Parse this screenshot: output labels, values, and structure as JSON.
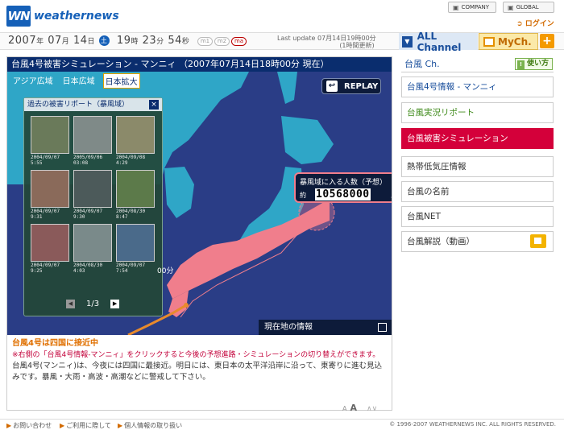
{
  "header": {
    "logo_mark": "WN",
    "logo_text": "weathernews",
    "company_label": "COMPANY",
    "global_label": "GLOBAL",
    "login_label": "ログイン"
  },
  "datebar": {
    "year": "2007",
    "y_unit": "年",
    "month": "07",
    "m_unit": "月",
    "day": "14",
    "d_unit": "日",
    "weekday": "土",
    "hour": "19",
    "h_unit": "時",
    "minute": "23",
    "min_unit": "分",
    "second": "54",
    "s_unit": "秒",
    "pills": [
      "m1",
      "m2",
      "ma"
    ],
    "update_text": "Last update  07月14日19時00分",
    "update_sub": "(1時間更新)",
    "all_channel": "ALL Channel",
    "my_ch": "MyCh.",
    "plus": "+"
  },
  "main": {
    "title": "台風4号被害シミュレーション - マンニィ （2007年07月14日18時00分 現在）",
    "tabs": [
      {
        "label": "アジア広域",
        "active": false
      },
      {
        "label": "日本広域",
        "active": false
      },
      {
        "label": "日本拡大",
        "active": true
      }
    ],
    "replay_label": "REPLAY",
    "report": {
      "title": "過去の被害リポート（暴風域）",
      "close": "×",
      "items": [
        {
          "cap": "2004/09/07\n5:55",
          "color": "#6a7a5a"
        },
        {
          "cap": "2005/09/06\n03:08",
          "color": "#7f8a88"
        },
        {
          "cap": "2004/09/08\n4:29",
          "color": "#8b8a6a"
        },
        {
          "cap": "2004/09/07\n9:31",
          "color": "#8a6a5a"
        },
        {
          "cap": "2004/09/07\n9:30",
          "color": "#4c5a5a"
        },
        {
          "cap": "2004/08/30\n8:47",
          "color": "#5c7a4a"
        },
        {
          "cap": "2004/09/07\n9:25",
          "color": "#8a5a5a"
        },
        {
          "cap": "2004/08/30\n4:03",
          "color": "#7a8a8a"
        },
        {
          "cap": "2004/09/07\n7:54",
          "color": "#4a6a8a"
        }
      ],
      "page": "1/3"
    },
    "count": {
      "label": "暴風域に入る人数（予想）",
      "approx": "約",
      "number": "10568000",
      "unit": "人"
    },
    "map_time": "00分",
    "current_location": "現在地の情報",
    "info": {
      "headline": "台風4号は四国に接近中",
      "note": "※右側の「台風4号情報-マンニィ」をクリックすると今後の予想進路・シミュレーションの切り替えができます。",
      "body": "台風4号(マンニィ)は、今夜には四国に最接近。明日には、東日本の太平洋沿岸に沿って、東寄りに進む見込みです。暴風・大雨・高波・高潮などに警戒して下さい。"
    },
    "font_small": "A",
    "font_large": "A",
    "font_ud": "∧∨"
  },
  "right": {
    "head": "台風 Ch.",
    "usage": "使い方",
    "menu": [
      {
        "label": "台風4号情報 - マンニィ",
        "style": "blue"
      },
      {
        "label": "台風実況リポート",
        "style": "green"
      },
      {
        "label": "台風被害シミュレーション",
        "style": "active"
      },
      {
        "label": "熱帯低気圧情報",
        "style": "gray"
      },
      {
        "label": "台風の名前",
        "style": "gray"
      },
      {
        "label": "台風NET",
        "style": "gray"
      },
      {
        "label": "台風解説（動画）",
        "style": "gray"
      }
    ]
  },
  "footer": {
    "links": [
      "お問い合わせ",
      "ご利用に際して",
      "個人情報の取り扱い"
    ],
    "copyright": "© 1996-2007 WEATHERNEWS INC. ALL RIGHTS RESERVED."
  },
  "colors": {
    "brand_blue": "#1560b8",
    "storm_pink": "#f07e8c",
    "active_red": "#d4003a",
    "sea": "#2a3d86",
    "land": "#2fa6c7"
  }
}
